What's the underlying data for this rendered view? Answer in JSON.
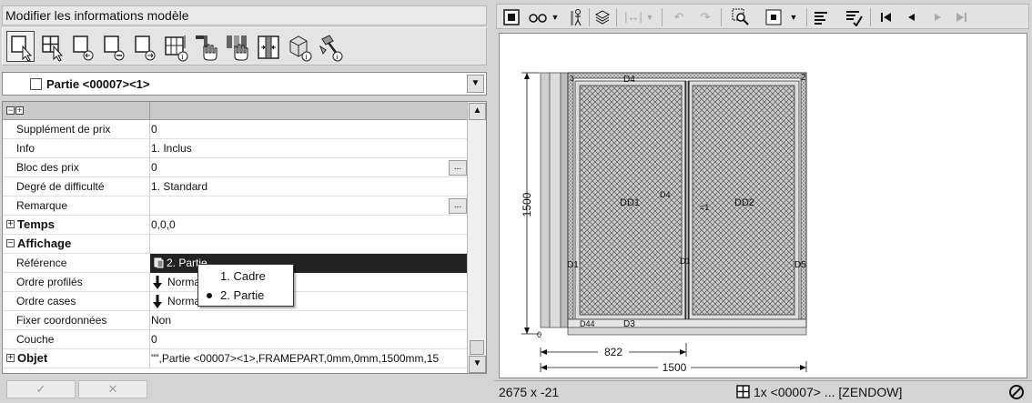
{
  "panel": {
    "title": "Modifier les informations modèle",
    "toolbar_icons": [
      "select-frame-icon",
      "grid-select-icon",
      "remove-left-icon",
      "remove-minus-icon",
      "remove-right-icon",
      "grid-info-icon",
      "hand-tool-icon",
      "hand-multi-icon",
      "mullion-icon",
      "box-info-icon",
      "hammer-info-icon"
    ]
  },
  "selector": {
    "value": "Partie <00007><1>"
  },
  "grid": {
    "header_expand": "−",
    "header_collapse": "+",
    "rows": [
      {
        "label": "Supplément de prix",
        "value": "0"
      },
      {
        "label": "Info",
        "value": "1. Inclus"
      },
      {
        "label": "Bloc des prix",
        "value": "0",
        "button": "..."
      },
      {
        "label": "Degré de difficulté",
        "value": "1. Standard"
      },
      {
        "label": "Remarque",
        "value": "",
        "button": "..."
      },
      {
        "label": "Temps",
        "value": "0,0,0",
        "group": "+"
      },
      {
        "label": "Affichage",
        "value": "",
        "group": "−"
      },
      {
        "label": "Référence",
        "value": "2. Partie"
      },
      {
        "label": "Ordre profilés",
        "value": "Normal"
      },
      {
        "label": "Ordre cases",
        "value": "Normal"
      },
      {
        "label": "Fixer coordonnées",
        "value": "Non"
      },
      {
        "label": "Couche",
        "value": "0"
      },
      {
        "label": "Objet",
        "value": "\"\",Partie <00007><1>,FRAMEPART,0mm,0mm,1500mm,15",
        "group": "+"
      }
    ]
  },
  "popup": {
    "options": [
      "1. Cadre",
      "2. Partie"
    ],
    "selected": "2. Partie"
  },
  "buttons": {
    "ok_symbol": "✓",
    "cancel_symbol": "✕"
  },
  "drawing": {
    "dim_height": "1500",
    "dim_width_partial": "822",
    "dim_width_total": "1500",
    "labels": {
      "top": "D4",
      "left_pane": "DD1",
      "right_pane": "DD2",
      "mid_top": "D4",
      "mid_right": "=1",
      "left_side": "D1",
      "mid_center": "D1",
      "right_side": "D5",
      "bottom_left": "D44",
      "bottom": "D3",
      "corner_tl": "3",
      "corner_tr": "2",
      "corner_bl": "0"
    }
  },
  "status": {
    "coords": "2675 x -21",
    "model": "1x <00007> ... [ZENDOW]"
  },
  "colors": {
    "selected_row": "#222222",
    "background": "#d4d4d4"
  }
}
